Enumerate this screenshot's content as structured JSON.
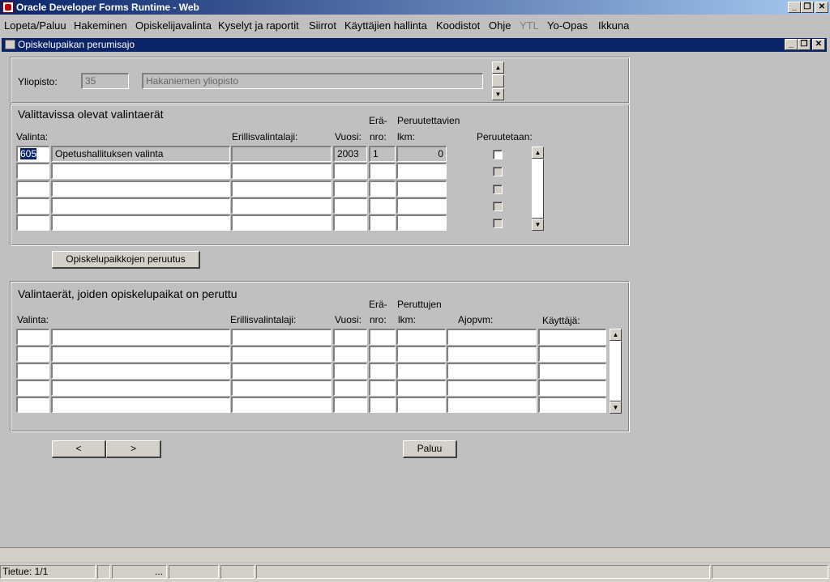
{
  "app": {
    "title": "Oracle Developer Forms Runtime - Web",
    "minimize": "_",
    "restore": "❐",
    "close": "✕"
  },
  "menu": [
    "Lopeta/Paluu",
    "Hakeminen",
    "Opiskelijavalinta",
    "Kyselyt ja raportit",
    "Siirrot",
    "Käyttäjien hallinta",
    "Koodistot",
    "Ohje",
    "YTL",
    "Yo-Opas",
    "Ikkuna"
  ],
  "window": {
    "title": "Opiskelupaikan perumisajo"
  },
  "yliopisto": {
    "label": "Yliopisto:",
    "code": "35",
    "name": "Hakaniemen yliopisto"
  },
  "available": {
    "section_title": "Valittavissa olevat valintaerät",
    "headers": {
      "valinta": "Valinta:",
      "erillis": "Erillisvalintalaji:",
      "vuosi": "Vuosi:",
      "era1": "Erä-",
      "era2": "nro:",
      "peru1": "Peruutettavien",
      "peru2": "lkm:",
      "peruutetaan": "Peruutetaan:"
    },
    "rows": [
      {
        "valinta": "605",
        "nimi": "Opetushallituksen valinta",
        "erillis": "",
        "vuosi": "2003",
        "era": "1",
        "lkm": "0",
        "checked": false
      },
      {
        "valinta": "",
        "nimi": "",
        "erillis": "",
        "vuosi": "",
        "era": "",
        "lkm": "",
        "checked": false
      },
      {
        "valinta": "",
        "nimi": "",
        "erillis": "",
        "vuosi": "",
        "era": "",
        "lkm": "",
        "checked": false
      },
      {
        "valinta": "",
        "nimi": "",
        "erillis": "",
        "vuosi": "",
        "era": "",
        "lkm": "",
        "checked": false
      },
      {
        "valinta": "",
        "nimi": "",
        "erillis": "",
        "vuosi": "",
        "era": "",
        "lkm": "",
        "checked": false
      }
    ]
  },
  "cancel_button": "Opiskelupaikkojen peruutus",
  "cancelled": {
    "section_title": "Valintaerät, joiden opiskelupaikat on peruttu",
    "headers": {
      "valinta": "Valinta:",
      "erillis": "Erillisvalintalaji:",
      "vuosi": "Vuosi:",
      "era1": "Erä-",
      "era2": "nro:",
      "peru1": "Peruttujen",
      "peru2": "lkm:",
      "ajopvm": "Ajopvm:",
      "kayttaja": "Käyttäjä:"
    }
  },
  "nav": {
    "prev": "<",
    "next": ">",
    "back": "Paluu"
  },
  "status": {
    "record": "Tietue: 1/1",
    "ellipsis": "..."
  },
  "icons": {
    "up": "▲",
    "down": "▼"
  }
}
